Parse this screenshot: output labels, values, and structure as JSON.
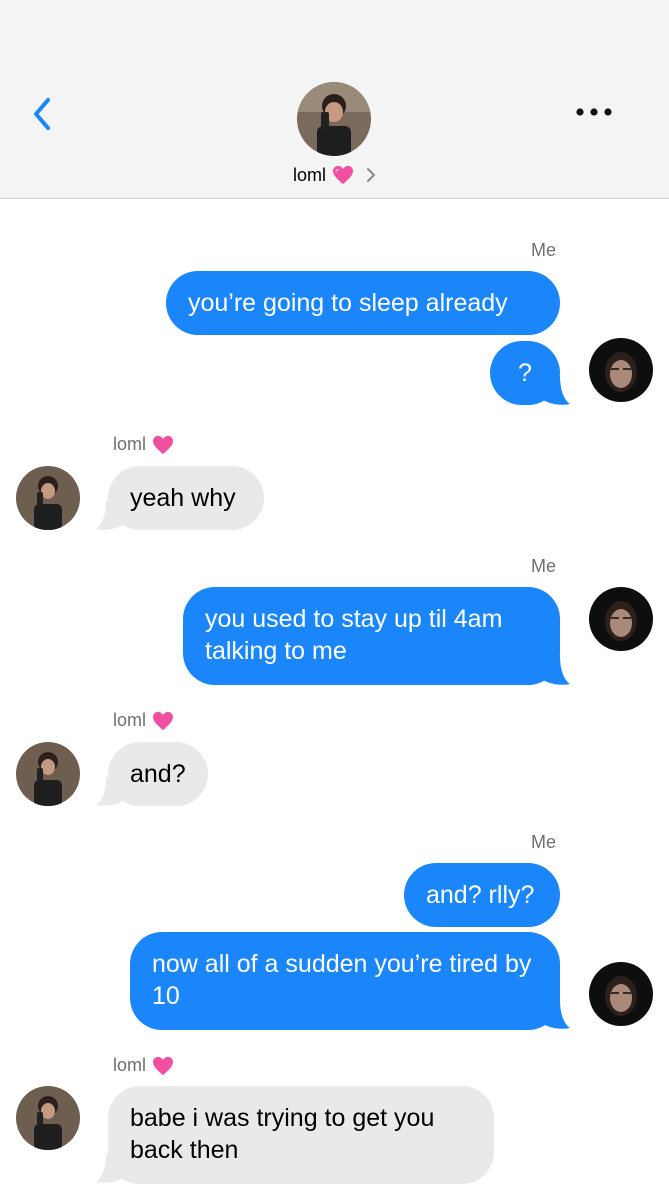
{
  "header": {
    "contact_name": "loml",
    "contact_emoji_icon": "pink-heart-icon",
    "back_icon": "chevron-left-icon",
    "more_icon": "ellipsis-icon",
    "accent_color": "#1b86f9"
  },
  "senders": {
    "me": "Me",
    "them": "loml"
  },
  "messages": [
    {
      "from": "me",
      "text": "you’re going to sleep already"
    },
    {
      "from": "me",
      "text": "?"
    },
    {
      "from": "them",
      "text": "yeah why"
    },
    {
      "from": "me",
      "text": "you used to stay up til 4am talking to me"
    },
    {
      "from": "them",
      "text": "and?"
    },
    {
      "from": "me",
      "text": "and? rlly?"
    },
    {
      "from": "me",
      "text": "now all of a sudden you’re tired by 10"
    },
    {
      "from": "them",
      "text": "babe i was trying to get you back then"
    }
  ],
  "colors": {
    "me_bubble": "#1b86f9",
    "them_bubble": "#e9e9eb",
    "header_bg": "#f4f4f4"
  }
}
